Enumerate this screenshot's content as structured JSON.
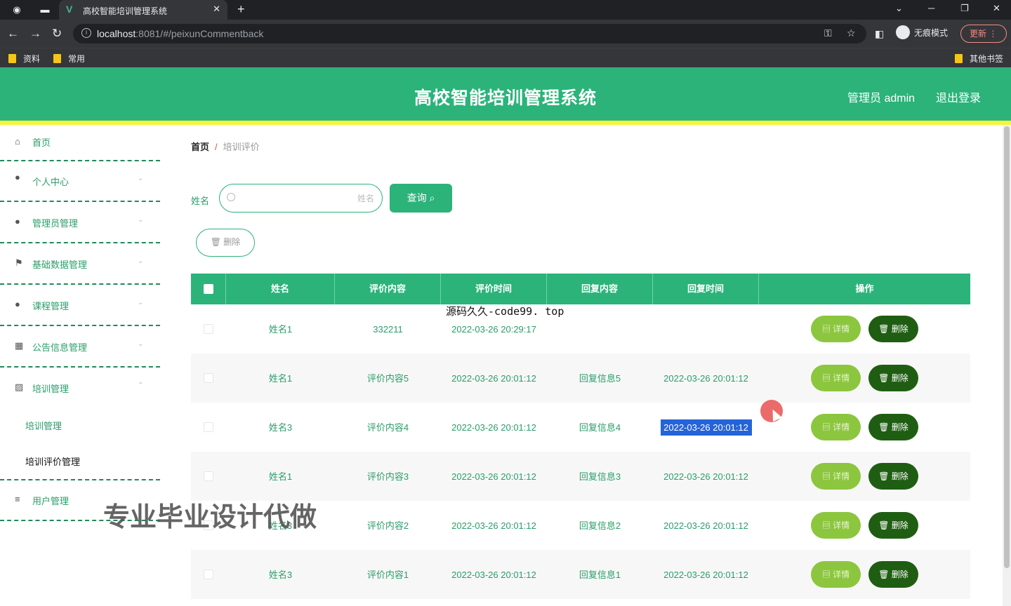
{
  "browser": {
    "tab_title": "高校智能培训管理系统",
    "url_host": "localhost",
    "url_rest": ":8081/#/peixunCommentback",
    "incognito_label": "无痕模式",
    "update_label": "更新",
    "bookmarks": [
      "资料",
      "常用"
    ],
    "other_bookmarks": "其他书签"
  },
  "header": {
    "title": "高校智能培训管理系统",
    "user_label": "管理员 admin",
    "logout_label": "退出登录"
  },
  "sidebar": {
    "items": [
      {
        "label": "首页",
        "icon": "home-icon"
      },
      {
        "label": "个人中心",
        "icon": "user-icon"
      },
      {
        "label": "管理员管理",
        "icon": "pin-icon"
      },
      {
        "label": "基础数据管理",
        "icon": "flag-icon"
      },
      {
        "label": "课程管理",
        "icon": "user-icon"
      },
      {
        "label": "公告信息管理",
        "icon": "grid-icon"
      },
      {
        "label": "培训管理",
        "icon": "chart-icon"
      },
      {
        "label": "用户管理",
        "icon": "layers-icon"
      }
    ],
    "subitems": [
      "培训管理",
      "培训评价管理"
    ]
  },
  "breadcrumb": {
    "home": "首页",
    "sep": "/",
    "current": "培训评价"
  },
  "search": {
    "label": "姓名",
    "placeholder": "姓名",
    "button_label": "查询",
    "delete_label": "删除"
  },
  "table": {
    "headers": [
      "姓名",
      "评价内容",
      "评价时间",
      "回复内容",
      "回复时间",
      "操作"
    ],
    "detail_label": "详情",
    "delete_label": "删除",
    "rows": [
      {
        "name": "姓名1",
        "content": "332211",
        "time": "2022-03-26 20:29:17",
        "reply": "",
        "reply_time": ""
      },
      {
        "name": "姓名1",
        "content": "评价内容5",
        "time": "2022-03-26 20:01:12",
        "reply": "回复信息5",
        "reply_time": "2022-03-26 20:01:12"
      },
      {
        "name": "姓名3",
        "content": "评价内容4",
        "time": "2022-03-26 20:01:12",
        "reply": "回复信息4",
        "reply_time": "2022-03-26 20:01:12"
      },
      {
        "name": "姓名1",
        "content": "评价内容3",
        "time": "2022-03-26 20:01:12",
        "reply": "回复信息3",
        "reply_time": "2022-03-26 20:01:12"
      },
      {
        "name": "姓名3",
        "content": "评价内容2",
        "time": "2022-03-26 20:01:12",
        "reply": "回复信息2",
        "reply_time": "2022-03-26 20:01:12"
      },
      {
        "name": "姓名3",
        "content": "评价内容1",
        "time": "2022-03-26 20:01:12",
        "reply": "回复信息1",
        "reply_time": "2022-03-26 20:01:12"
      }
    ]
  },
  "overlays": {
    "source_text": "源码久久-code99. top",
    "promo_text": "专业毕业设计代做"
  }
}
